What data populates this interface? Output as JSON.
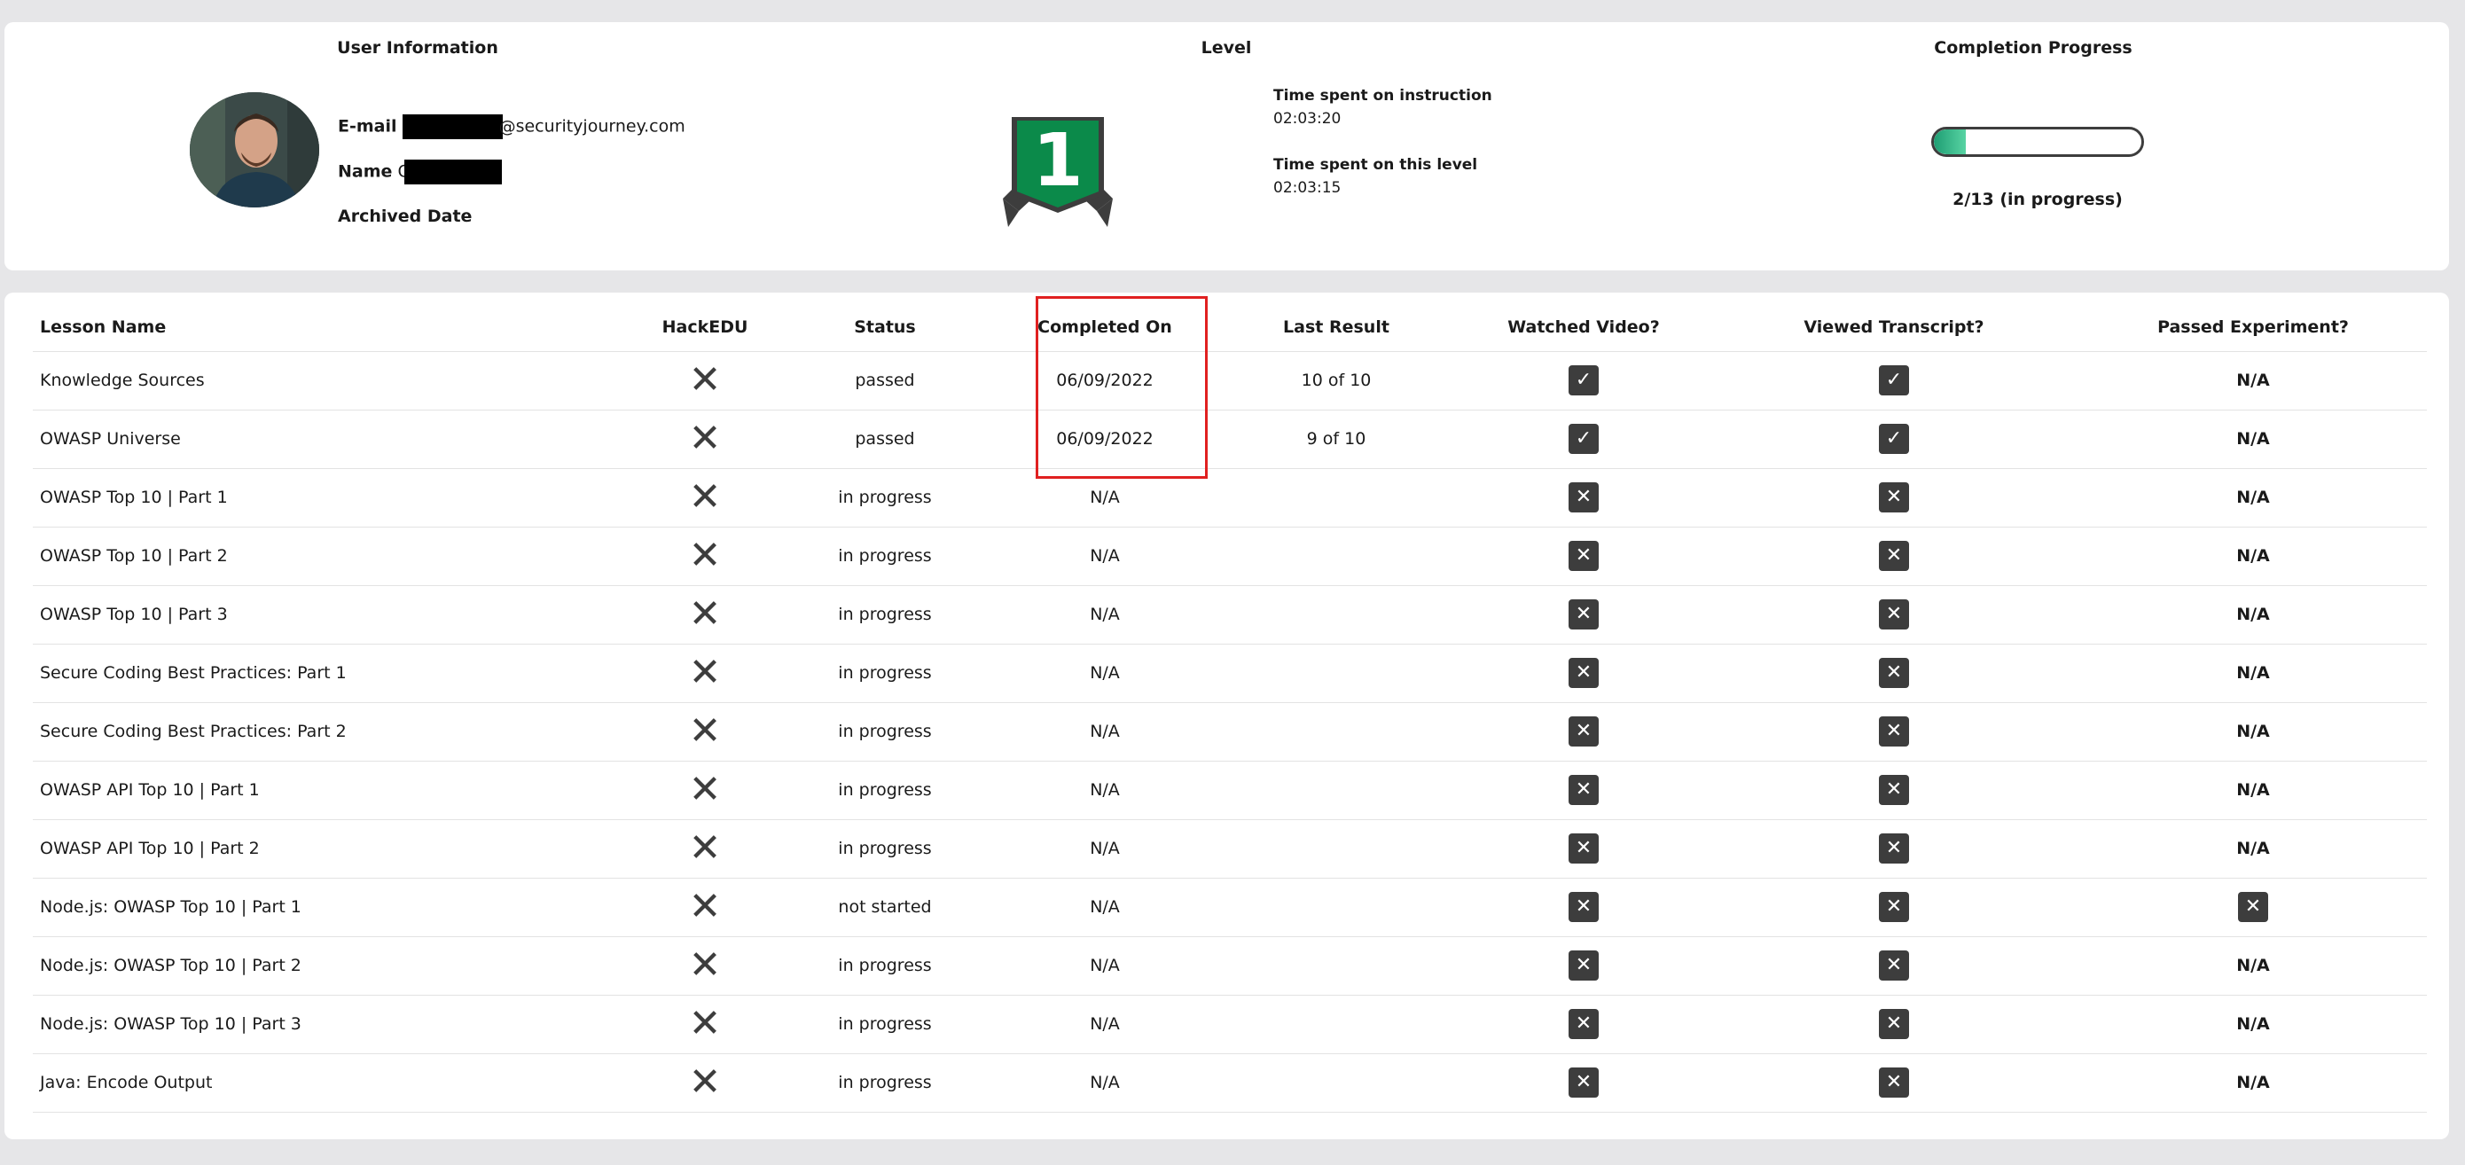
{
  "user_info": {
    "heading": "User Information",
    "email_label": "E-mail",
    "email_domain": "securityjourney.com",
    "name_label": "Name",
    "name_initial": "C",
    "archived_label": "Archived Date"
  },
  "level": {
    "heading": "Level",
    "badge_number": "1",
    "badge_color": "#0b8a4a",
    "time_instruction_label": "Time spent on instruction",
    "time_instruction_value": "02:03:20",
    "time_level_label": "Time spent on this level",
    "time_level_value": "02:03:15"
  },
  "completion": {
    "heading": "Completion Progress",
    "text": "2/13 (in progress)",
    "fraction": 0.154
  },
  "table": {
    "headers": {
      "lesson_name": "Lesson Name",
      "hackedu": "HackEDU",
      "status": "Status",
      "completed_on": "Completed On",
      "last_result": "Last Result",
      "watched_video": "Watched Video?",
      "viewed_transcript": "Viewed Transcript?",
      "passed_experiment": "Passed Experiment?"
    },
    "rows": [
      {
        "name": "Knowledge Sources",
        "hackedu": "✕",
        "status": "passed",
        "completed_on": "06/09/2022",
        "last_result": "10 of 10",
        "video": "✓",
        "transcript": "✓",
        "experiment": "N/A"
      },
      {
        "name": "OWASP Universe",
        "hackedu": "✕",
        "status": "passed",
        "completed_on": "06/09/2022",
        "last_result": "9 of 10",
        "video": "✓",
        "transcript": "✓",
        "experiment": "N/A"
      },
      {
        "name": "OWASP Top 10 | Part 1",
        "hackedu": "✕",
        "status": "in progress",
        "completed_on": "N/A",
        "last_result": "",
        "video": "✕",
        "transcript": "✕",
        "experiment": "N/A"
      },
      {
        "name": "OWASP Top 10 | Part 2",
        "hackedu": "✕",
        "status": "in progress",
        "completed_on": "N/A",
        "last_result": "",
        "video": "✕",
        "transcript": "✕",
        "experiment": "N/A"
      },
      {
        "name": "OWASP Top 10 | Part 3",
        "hackedu": "✕",
        "status": "in progress",
        "completed_on": "N/A",
        "last_result": "",
        "video": "✕",
        "transcript": "✕",
        "experiment": "N/A"
      },
      {
        "name": "Secure Coding Best Practices: Part 1",
        "hackedu": "✕",
        "status": "in progress",
        "completed_on": "N/A",
        "last_result": "",
        "video": "✕",
        "transcript": "✕",
        "experiment": "N/A"
      },
      {
        "name": "Secure Coding Best Practices: Part 2",
        "hackedu": "✕",
        "status": "in progress",
        "completed_on": "N/A",
        "last_result": "",
        "video": "✕",
        "transcript": "✕",
        "experiment": "N/A"
      },
      {
        "name": "OWASP API Top 10 | Part 1",
        "hackedu": "✕",
        "status": "in progress",
        "completed_on": "N/A",
        "last_result": "",
        "video": "✕",
        "transcript": "✕",
        "experiment": "N/A"
      },
      {
        "name": "OWASP API Top 10 | Part 2",
        "hackedu": "✕",
        "status": "in progress",
        "completed_on": "N/A",
        "last_result": "",
        "video": "✕",
        "transcript": "✕",
        "experiment": "N/A"
      },
      {
        "name": "Node.js: OWASP Top 10 | Part 1",
        "hackedu": "✕",
        "status": "not started",
        "completed_on": "N/A",
        "last_result": "",
        "video": "✕",
        "transcript": "✕",
        "experiment": "✕"
      },
      {
        "name": "Node.js: OWASP Top 10 | Part 2",
        "hackedu": "✕",
        "status": "in progress",
        "completed_on": "N/A",
        "last_result": "",
        "video": "✕",
        "transcript": "✕",
        "experiment": "N/A"
      },
      {
        "name": "Node.js: OWASP Top 10 | Part 3",
        "hackedu": "✕",
        "status": "in progress",
        "completed_on": "N/A",
        "last_result": "",
        "video": "✕",
        "transcript": "✕",
        "experiment": "N/A"
      },
      {
        "name": "Java: Encode Output",
        "hackedu": "✕",
        "status": "in progress",
        "completed_on": "N/A",
        "last_result": "",
        "video": "✕",
        "transcript": "✕",
        "experiment": "N/A"
      }
    ]
  }
}
